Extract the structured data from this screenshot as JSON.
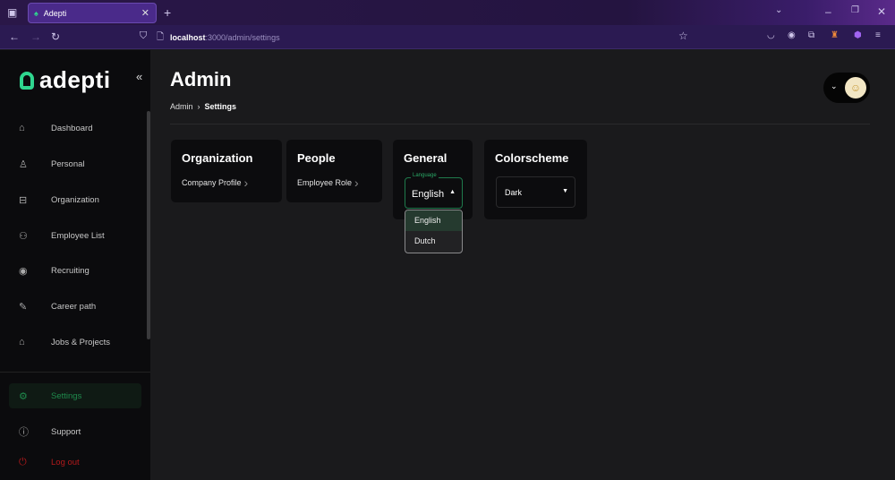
{
  "browser": {
    "tab_title": "Adepti",
    "url_host": "localhost",
    "url_path": ":3000/admin/settings"
  },
  "sidebar": {
    "logo": "adepti",
    "items": [
      {
        "label": "Dashboard",
        "icon": "home-icon"
      },
      {
        "label": "Personal",
        "icon": "user-icon"
      },
      {
        "label": "Organization",
        "icon": "briefcase-icon"
      },
      {
        "label": "Employee List",
        "icon": "users-icon"
      },
      {
        "label": "Recruiting",
        "icon": "eye-icon"
      },
      {
        "label": "Career path",
        "icon": "pencil-icon"
      },
      {
        "label": "Jobs & Projects",
        "icon": "jobs-icon"
      }
    ],
    "bottom": [
      {
        "label": "Settings",
        "icon": "gear-icon"
      },
      {
        "label": "Support",
        "icon": "info-icon"
      },
      {
        "label": "Log out",
        "icon": "power-icon"
      }
    ]
  },
  "page": {
    "title": "Admin",
    "breadcrumb": [
      "Admin",
      "Settings"
    ]
  },
  "cards": {
    "organization": {
      "title": "Organization",
      "link": "Company Profile"
    },
    "people": {
      "title": "People",
      "link": "Employee Role"
    },
    "general": {
      "title": "General",
      "language_label": "Language",
      "language_value": "English",
      "options": [
        "English",
        "Dutch"
      ]
    },
    "colorscheme": {
      "title": "Colorscheme",
      "value": "Dark"
    }
  },
  "colors": {
    "accent": "#2fd68f",
    "active": "#1f8a4c",
    "logout": "#b3191b"
  }
}
